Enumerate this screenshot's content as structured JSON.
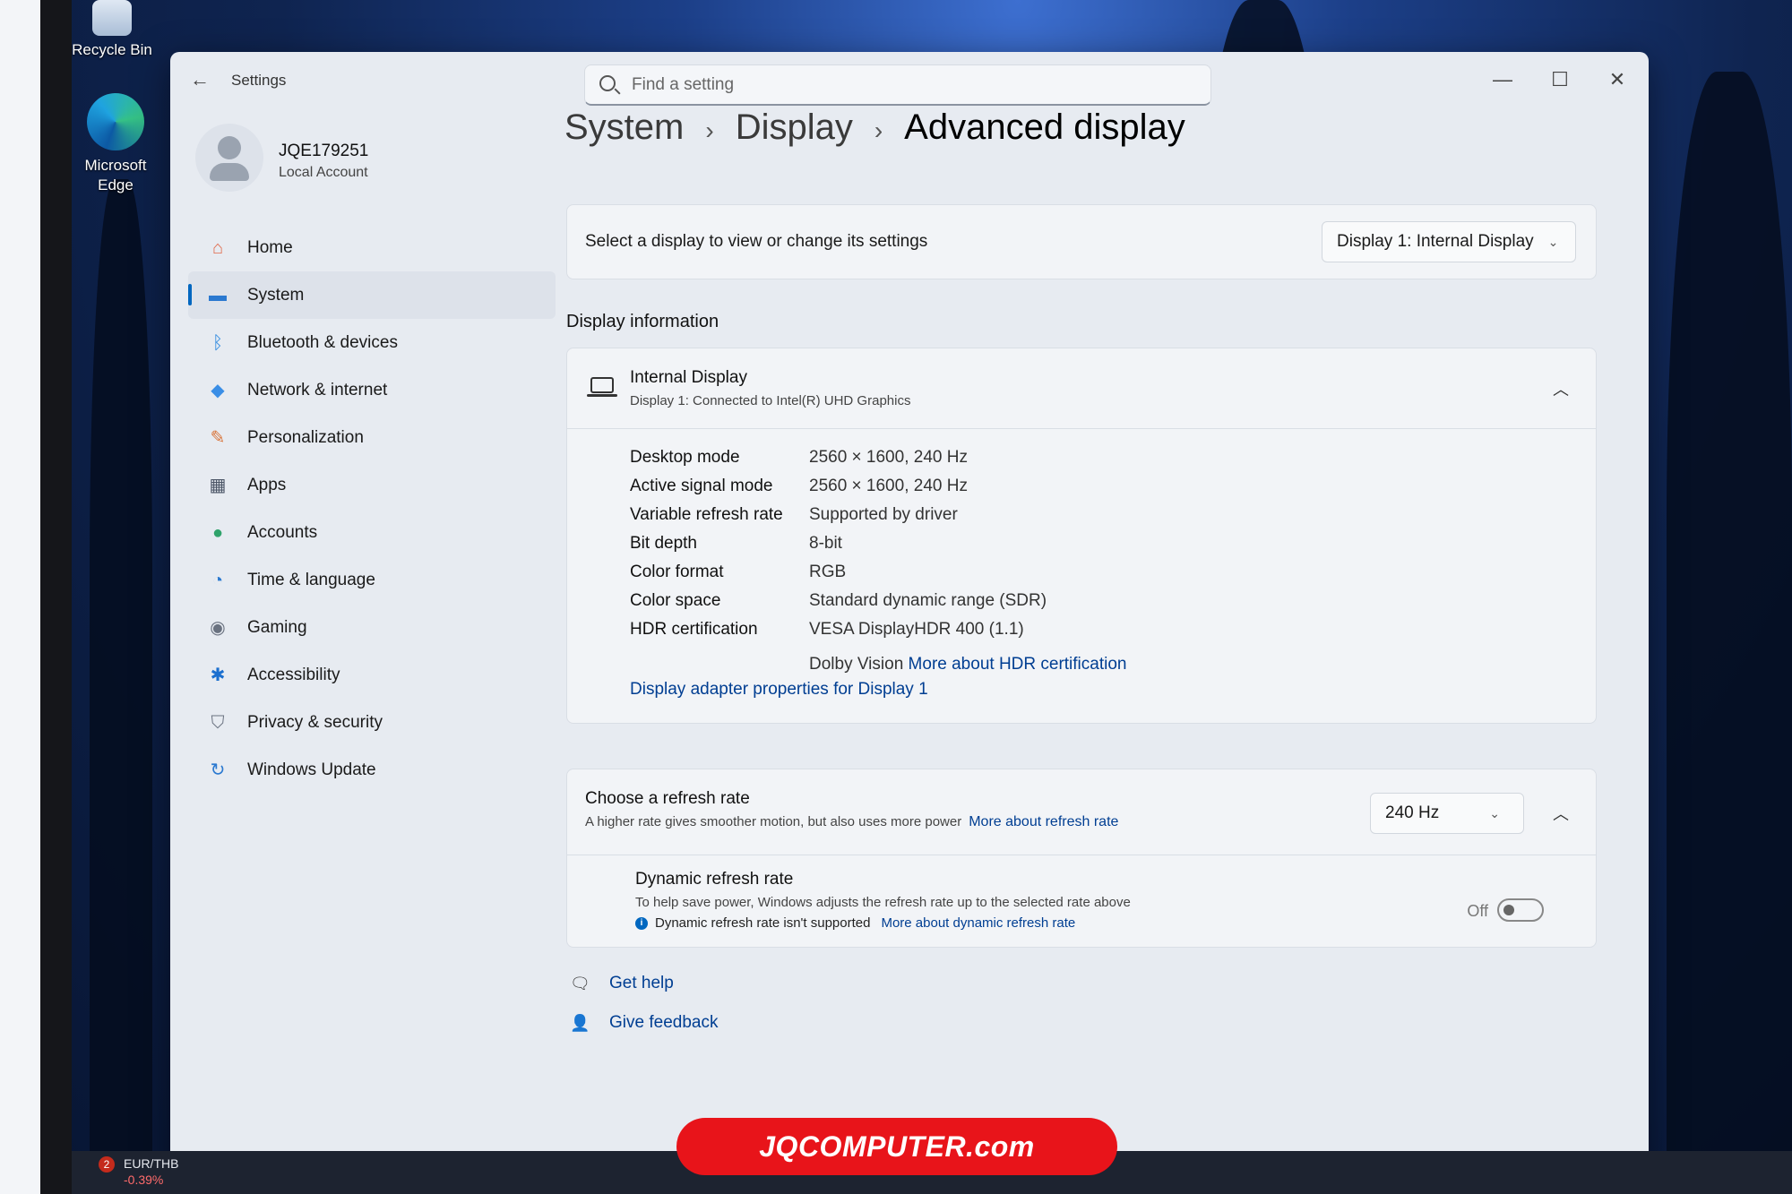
{
  "desktop": {
    "icons": [
      {
        "label": "Recycle Bin"
      },
      {
        "label": "Microsoft Edge"
      }
    ]
  },
  "window": {
    "app_title": "Settings",
    "search": {
      "placeholder": "Find a setting"
    },
    "controls": {
      "minimize": "—",
      "maximize": "☐",
      "close": "✕"
    }
  },
  "profile": {
    "name": "JQE179251",
    "type": "Local Account"
  },
  "nav": {
    "items": [
      {
        "label": "Home",
        "icon": "home-icon",
        "color": "#e0694a"
      },
      {
        "label": "System",
        "icon": "system-icon",
        "color": "#2b79d0"
      },
      {
        "label": "Bluetooth & devices",
        "icon": "bluetooth-icon",
        "color": "#2f8ae0"
      },
      {
        "label": "Network & internet",
        "icon": "wifi-icon",
        "color": "#3a8ee6"
      },
      {
        "label": "Personalization",
        "icon": "brush-icon",
        "color": "#d9743a"
      },
      {
        "label": "Apps",
        "icon": "apps-icon",
        "color": "#4b5566"
      },
      {
        "label": "Accounts",
        "icon": "accounts-icon",
        "color": "#2fa36b"
      },
      {
        "label": "Time & language",
        "icon": "globe-clock-icon",
        "color": "#2b79d0"
      },
      {
        "label": "Gaming",
        "icon": "gamepad-icon",
        "color": "#6a7280"
      },
      {
        "label": "Accessibility",
        "icon": "accessibility-icon",
        "color": "#1b6fcf"
      },
      {
        "label": "Privacy & security",
        "icon": "shield-icon",
        "color": "#6a7280"
      },
      {
        "label": "Windows Update",
        "icon": "update-icon",
        "color": "#2b79d0"
      }
    ],
    "active_index": 1
  },
  "breadcrumb": {
    "level1": "System",
    "level2": "Display",
    "current": "Advanced display",
    "sep": "›"
  },
  "select_display": {
    "text": "Select a display to view or change its settings",
    "value": "Display 1: Internal Display"
  },
  "display_info": {
    "section_title": "Display information",
    "name": "Internal Display",
    "subtitle": "Display 1: Connected to Intel(R) UHD Graphics",
    "rows": [
      {
        "key": "Desktop mode",
        "value": "2560 × 1600, 240 Hz"
      },
      {
        "key": "Active signal mode",
        "value": "2560 × 1600, 240 Hz"
      },
      {
        "key": "Variable refresh rate",
        "value": "Supported by driver"
      },
      {
        "key": "Bit depth",
        "value": "8-bit"
      },
      {
        "key": "Color format",
        "value": "RGB"
      },
      {
        "key": "Color space",
        "value": "Standard dynamic range (SDR)"
      },
      {
        "key": "HDR certification",
        "value": "VESA DisplayHDR 400 (1.1)"
      }
    ],
    "hdr_extra": "Dolby Vision",
    "hdr_link": "More about HDR certification",
    "adapter_link": "Display adapter properties for Display 1"
  },
  "refresh": {
    "title": "Choose a refresh rate",
    "desc": "A higher rate gives smoother motion, but also uses more power",
    "link": "More about refresh rate",
    "value": "240 Hz",
    "dynamic": {
      "title": "Dynamic refresh rate",
      "desc": "To help save power, Windows adjusts the refresh rate up to the selected rate above",
      "note": "Dynamic refresh rate isn't supported",
      "link": "More about dynamic refresh rate",
      "state": "Off"
    }
  },
  "help": {
    "get_help": "Get help",
    "feedback": "Give feedback"
  },
  "banner": {
    "text": "JQCOMPUTER.com"
  },
  "taskbar": {
    "widget_badge": "2",
    "widget_label": "EUR/THB",
    "widget_change": "-0.39%"
  }
}
